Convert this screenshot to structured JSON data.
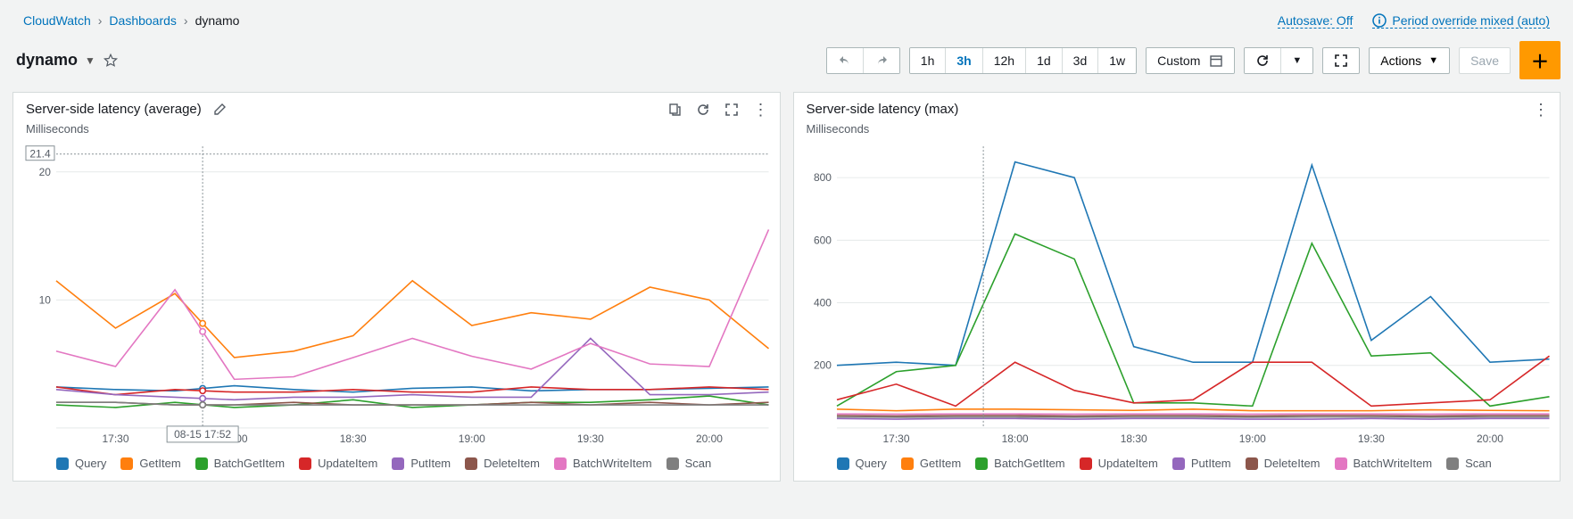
{
  "breadcrumbs": [
    "CloudWatch",
    "Dashboards",
    "dynamo"
  ],
  "header": {
    "autosave_label": "Autosave: Off",
    "period_label": "Period override mixed (auto)",
    "title": "dynamo"
  },
  "toolbar": {
    "ranges": [
      "1h",
      "3h",
      "12h",
      "1d",
      "3d",
      "1w"
    ],
    "active_range": "3h",
    "custom_label": "Custom",
    "actions_label": "Actions",
    "save_label": "Save"
  },
  "series_colors": {
    "Query": "#1f77b4",
    "GetItem": "#ff7f0e",
    "BatchGetItem": "#2ca02c",
    "UpdateItem": "#d62728",
    "PutItem": "#9467bd",
    "DeleteItem": "#8c564b",
    "BatchWriteItem": "#e377c2",
    "Scan": "#7f7f7f"
  },
  "series_order": [
    "Query",
    "GetItem",
    "BatchGetItem",
    "UpdateItem",
    "PutItem",
    "DeleteItem",
    "BatchWriteItem",
    "Scan"
  ],
  "x_categories": [
    "17:15",
    "17:30",
    "17:45",
    "18:00",
    "18:15",
    "18:30",
    "18:45",
    "19:00",
    "19:15",
    "19:30",
    "19:45",
    "20:00",
    "20:15"
  ],
  "x_ticks": [
    "17:30",
    "18:00",
    "18:30",
    "19:00",
    "19:30",
    "20:00"
  ],
  "panel_avg": {
    "title": "Server-side latency (average)",
    "unit": "Milliseconds",
    "ylim": [
      0,
      22
    ],
    "yticks": [
      10,
      20
    ],
    "crosshair_x": "17:52",
    "crosshair_y": 21.4,
    "tooltip": "08-15 17:52"
  },
  "panel_max": {
    "title": "Server-side latency (max)",
    "unit": "Milliseconds",
    "ylim": [
      0,
      900
    ],
    "yticks": [
      200,
      400,
      600,
      800
    ],
    "crosshair_x": "17:52"
  },
  "chart_data": [
    {
      "type": "line",
      "title": "Server-side latency (average)",
      "ylabel": "Milliseconds",
      "ylim": [
        0,
        22
      ],
      "x": [
        "17:15",
        "17:30",
        "17:45",
        "18:00",
        "18:15",
        "18:30",
        "18:45",
        "19:00",
        "19:15",
        "19:30",
        "19:45",
        "20:00",
        "20:15"
      ],
      "series": [
        {
          "name": "Query",
          "values": [
            3.2,
            3.0,
            2.9,
            3.3,
            3.0,
            2.8,
            3.1,
            3.2,
            2.9,
            3.0,
            3.0,
            3.1,
            3.2
          ]
        },
        {
          "name": "GetItem",
          "values": [
            11.5,
            7.8,
            10.5,
            5.5,
            6.0,
            7.2,
            11.5,
            8.0,
            9.0,
            8.5,
            11.0,
            10.0,
            6.2
          ]
        },
        {
          "name": "BatchGetItem",
          "values": [
            1.8,
            1.6,
            2.0,
            1.6,
            1.8,
            2.2,
            1.6,
            1.8,
            2.0,
            2.0,
            2.2,
            2.5,
            1.8
          ]
        },
        {
          "name": "UpdateItem",
          "values": [
            3.2,
            2.6,
            3.0,
            2.8,
            2.8,
            3.0,
            2.8,
            2.8,
            3.2,
            3.0,
            3.0,
            3.2,
            3.0
          ]
        },
        {
          "name": "PutItem",
          "values": [
            3.0,
            2.6,
            2.4,
            2.2,
            2.4,
            2.4,
            2.6,
            2.4,
            2.4,
            7.0,
            2.6,
            2.6,
            2.8
          ]
        },
        {
          "name": "DeleteItem",
          "values": [
            2.0,
            2.0,
            1.8,
            1.8,
            2.0,
            1.8,
            1.8,
            1.8,
            2.0,
            1.8,
            2.0,
            1.8,
            2.0
          ]
        },
        {
          "name": "BatchWriteItem",
          "values": [
            6.0,
            4.8,
            10.8,
            3.8,
            4.0,
            5.5,
            7.0,
            5.6,
            4.6,
            6.6,
            5.0,
            4.8,
            15.5
          ]
        },
        {
          "name": "Scan",
          "values": [
            2.0,
            2.0,
            1.8,
            1.8,
            1.8,
            1.8,
            1.8,
            1.8,
            1.8,
            1.8,
            1.8,
            1.8,
            1.8
          ]
        }
      ]
    },
    {
      "type": "line",
      "title": "Server-side latency (max)",
      "ylabel": "Milliseconds",
      "ylim": [
        0,
        900
      ],
      "x": [
        "17:15",
        "17:30",
        "17:45",
        "18:00",
        "18:15",
        "18:30",
        "18:45",
        "19:00",
        "19:15",
        "19:30",
        "19:45",
        "20:00",
        "20:15"
      ],
      "series": [
        {
          "name": "Query",
          "values": [
            200,
            210,
            200,
            850,
            800,
            260,
            210,
            210,
            840,
            280,
            420,
            210,
            220
          ]
        },
        {
          "name": "GetItem",
          "values": [
            60,
            55,
            60,
            60,
            58,
            56,
            60,
            55,
            55,
            55,
            58,
            56,
            55
          ]
        },
        {
          "name": "BatchGetItem",
          "values": [
            70,
            180,
            200,
            620,
            540,
            80,
            80,
            70,
            590,
            230,
            240,
            70,
            100
          ]
        },
        {
          "name": "UpdateItem",
          "values": [
            90,
            140,
            70,
            210,
            120,
            80,
            90,
            210,
            210,
            70,
            80,
            90,
            230
          ]
        },
        {
          "name": "PutItem",
          "values": [
            30,
            28,
            30,
            30,
            28,
            30,
            30,
            28,
            28,
            30,
            28,
            30,
            30
          ]
        },
        {
          "name": "DeleteItem",
          "values": [
            40,
            38,
            40,
            40,
            38,
            40,
            40,
            38,
            40,
            40,
            38,
            40,
            40
          ]
        },
        {
          "name": "BatchWriteItem",
          "values": [
            45,
            44,
            45,
            45,
            44,
            45,
            45,
            44,
            45,
            45,
            44,
            45,
            45
          ]
        },
        {
          "name": "Scan",
          "values": [
            35,
            34,
            35,
            35,
            34,
            35,
            35,
            34,
            35,
            35,
            34,
            35,
            35
          ]
        }
      ]
    }
  ]
}
